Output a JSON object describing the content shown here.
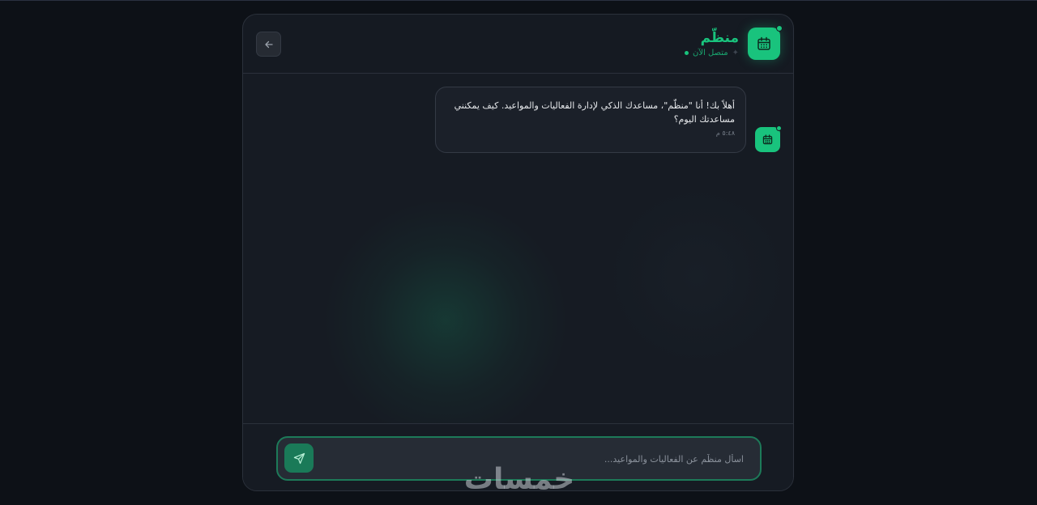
{
  "header": {
    "bot_name": "منظّم",
    "status": "متصل الآن",
    "avatar_icon": "calendar-icon",
    "back_icon": "arrow-left-icon",
    "sparkle_icon": "sparkle-icon"
  },
  "messages": [
    {
      "sender": "bot",
      "text": "أهلاً بك! أنا \"منظّم\"، مساعدك الذكي لإدارة الفعاليات والمواعيد. كيف يمكنني مساعدتك اليوم؟",
      "time": "٥:٤٨ م",
      "avatar_icon": "calendar-icon"
    }
  ],
  "composer": {
    "placeholder": "اسأل منظّم عن الفعاليات والمواعيد...",
    "value": "",
    "send_icon": "send-icon"
  },
  "watermark": "خمسات",
  "colors": {
    "accent": "#19c37d",
    "background": "#0d1117",
    "panel": "#151a22",
    "bubble": "#1b2029",
    "input_border": "#1d7a59"
  }
}
